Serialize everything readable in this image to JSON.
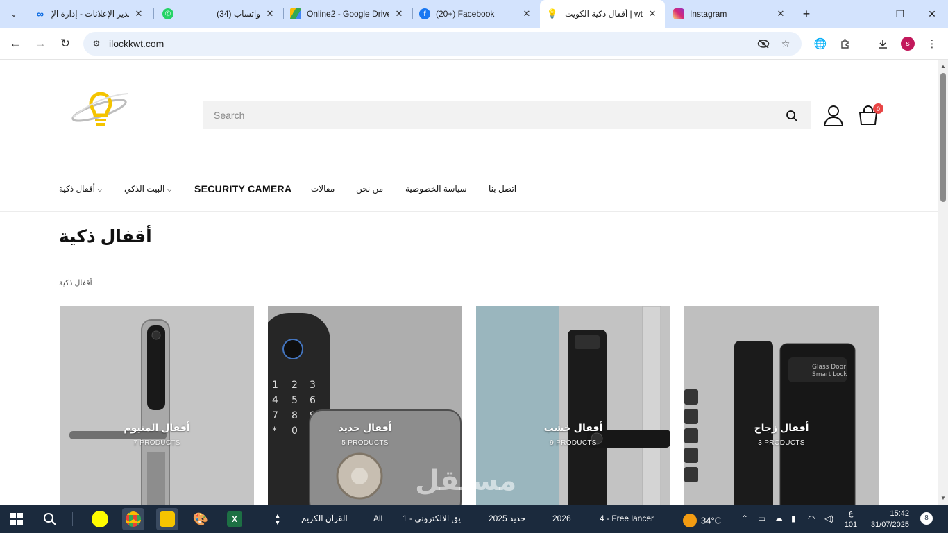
{
  "browser": {
    "tabs": [
      {
        "title": "مدير الإعلانات - إدارة الإ",
        "favicon": "meta-icon",
        "color": "#0668e1"
      },
      {
        "title": "(34) واتساب",
        "favicon": "whatsapp-icon",
        "color": "#25d366"
      },
      {
        "title": "Online2 - Google Drive",
        "favicon": "google-drive-icon",
        "color": "#34a853"
      },
      {
        "title": "(20+) Facebook",
        "favicon": "facebook-icon",
        "color": "#1877f2"
      },
      {
        "title": "أقفال ذكية الكويت | wt",
        "favicon": "bulb-icon",
        "color": "#f2c811",
        "active": true
      },
      {
        "title": "Instagram",
        "favicon": "instagram-icon",
        "color": "#dd2a7b"
      }
    ],
    "url": "ilockkwt.com",
    "profile_initial": "s"
  },
  "site": {
    "search_placeholder": "Search",
    "cart_count": "0",
    "menu": [
      {
        "label": "أقفال ذكية",
        "has_caret": true
      },
      {
        "label": "البيت الذكي",
        "has_caret": true
      },
      {
        "label": "SECURITY CAMERA",
        "has_caret": false
      },
      {
        "label": "مقالات",
        "has_caret": false
      },
      {
        "label": "من نحن",
        "has_caret": false
      },
      {
        "label": "سياسة الخصوصية",
        "has_caret": false
      },
      {
        "label": "اتصل بنا",
        "has_caret": false
      }
    ],
    "page_title": "أقفال ذكية",
    "breadcrumb": "أقفال ذكية",
    "categories": [
      {
        "name": "أقفال المنيوم",
        "count": "7 PRODUCTS"
      },
      {
        "name": "أقفال حديد",
        "count": "5 PRODUCTS"
      },
      {
        "name": "أقفال خشب",
        "count": "9 PRODUCTS"
      },
      {
        "name": "أقفال زجاج",
        "count": "3 PRODUCTS"
      }
    ],
    "watermark": "مستقل"
  },
  "taskbar": {
    "items": [
      {
        "label": "القرآن الكريم"
      },
      {
        "label": "All"
      },
      {
        "label": "1 - يق الالكتروني"
      },
      {
        "label": "جديد 2025"
      },
      {
        "label": "2026"
      },
      {
        "label": "4 - Free lancer"
      }
    ],
    "weather": "34°C",
    "lang_top": "ع",
    "lang_bottom": "101",
    "time": "15:42",
    "date": "31/07/2025",
    "notifications": "8"
  }
}
